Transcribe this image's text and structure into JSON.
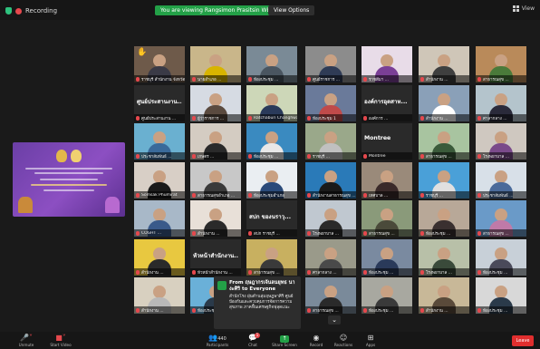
{
  "topbar": {
    "recording_label": "Recording",
    "viewing_banner": "You are viewing Rangsimon Prasitsin WBP's screen",
    "view_options_label": "View Options",
    "view_label": "View"
  },
  "chat_popup": {
    "from_label": "From ฤษฎากรเจ้นลนยุทธ นางะศิริ to Everyone",
    "message": "สำนักโรง ฝุ่นดำนลุ่มฤษฎษาศิริ ศูนย์ป้องกันและควบคุมการจัดการความสุขภาพ ภาคฟื้นเศรษฐกิจฟุลุดแนะ"
  },
  "toolbar": {
    "unmute_label": "Unmute",
    "start_video_label": "Start Video",
    "participants_label": "Participants",
    "participants_count": "440",
    "chat_label": "Chat",
    "chat_badge": "1",
    "share_screen_label": "Share Screen",
    "record_label": "Record",
    "reactions_label": "Reactions",
    "apps_label": "Apps",
    "leave_label": "Leave"
  },
  "tiles": [
    {
      "name": "ราชบุรี สำนักงาน จังหวัด",
      "video": true,
      "bg": "#6e5a4a",
      "body": "#3a3a46",
      "hand": true
    },
    {
      "name": "นายอำเภอ ...",
      "video": true,
      "bg": "#c9b68a",
      "body": "#d8b400"
    },
    {
      "name": "ห้องประชุม ...",
      "video": true,
      "bg": "#7a8a96",
      "body": "#4a5560"
    },
    {
      "name": "ศูนย์ราชการ ...",
      "video": true,
      "bg": "#8c8c8c",
      "body": "#2f3b55"
    },
    {
      "name": "ราชสีมา ...",
      "video": true,
      "bg": "#e8dce8",
      "body": "#7a3f96"
    },
    {
      "name": "สำนักงาน ...",
      "video": true,
      "bg": "#cfc6b8",
      "body": "#3f3f3f"
    },
    {
      "name": "สาธารณสุข ...",
      "video": true,
      "bg": "#b98a5a",
      "body": "#4a7a3a"
    },
    {
      "big": "ศูนย์ประสานงาน...",
      "name": "ศูนย์ประสานงาน ...",
      "video": false
    },
    {
      "name": "ผู้ว่าราชการ ...",
      "video": true,
      "bg": "#d6dbe3",
      "body": "#5a4a3f"
    },
    {
      "name": "Ratchaburi Changhwat",
      "video": true,
      "bg": "#cdd7b8",
      "body": "#2a3a5a"
    },
    {
      "name": "ห้องประชุม 1",
      "video": true,
      "bg": "#6a7a9a",
      "body": "#c04a4a"
    },
    {
      "big": "องค์การอุตสาห...",
      "name": "องค์การ ...",
      "video": false
    },
    {
      "name": "สำนักงาน ...",
      "video": true,
      "bg": "#8aa0b8",
      "body": "#ffffff"
    },
    {
      "name": "ศาลากลาง ...",
      "video": true,
      "bg": "#b4c4cc",
      "body": "#2a2a3a"
    },
    {
      "name": "ประชาสัมพันธ์ ...",
      "video": true,
      "bg": "#6ab0d0",
      "body": "#3a6a9a"
    },
    {
      "name": "เกษตร ...",
      "video": true,
      "bg": "#d4ccc2",
      "body": "#2a2a2a"
    },
    {
      "name": "ห้องประชุม ...",
      "video": true,
      "bg": "#3a8ac0",
      "body": "#e8e8e8"
    },
    {
      "name": "ราชบุรี ...",
      "video": true,
      "bg": "#9aa88a",
      "body": "#c0c0c0"
    },
    {
      "big": "Montree",
      "name": "Montree",
      "video": false
    },
    {
      "name": "สาธารณสุข ...",
      "video": true,
      "bg": "#a8c4a0",
      "body": "#3a5a3a"
    },
    {
      "name": "โรงพยาบาล ...",
      "video": true,
      "bg": "#cfc8c0",
      "body": "#7a4a8a"
    },
    {
      "name": "Somsak Phumirat",
      "video": true,
      "bg": "#d8cfc6",
      "body": "#1a1a1a"
    },
    {
      "name": "สาธารณสุขอำเภอ ...",
      "video": true,
      "bg": "#c8c8c8",
      "body": "#3a3a3a"
    },
    {
      "name": "ห้องประชุมอำเภอ",
      "video": true,
      "bg": "#eaeef2",
      "body": "#2a4a7a"
    },
    {
      "name": "สำนักงานสาธารณสุข ...",
      "video": true,
      "bg": "#2a7ab8",
      "body": "#1a1a1a"
    },
    {
      "name": "เทศบาล ...",
      "video": true,
      "bg": "#9a8a7a",
      "body": "#3a2a2a"
    },
    {
      "name": "ราชบุรี ...",
      "video": true,
      "bg": "#4aa0d8",
      "body": "#e0e0e0"
    },
    {
      "name": "ประชาสัมพันธ์ ...",
      "video": true,
      "bg": "#d8e0e8",
      "body": "#4a6a9a"
    },
    {
      "name": "COGHT ...",
      "video": true,
      "bg": "#a8b8c8",
      "body": "#3a5a8a"
    },
    {
      "name": "สำนักงาน ...",
      "video": true,
      "bg": "#e8e0d8",
      "body": "#2a2a2a"
    },
    {
      "big": "สปก ของนราวุ...",
      "name": "สปก ราชบุรี ...",
      "video": false
    },
    {
      "name": "โรงพยาบาล ...",
      "video": true,
      "bg": "#c0c8d0",
      "body": "#2a2a2a"
    },
    {
      "name": "สาธารณสุข ...",
      "video": true,
      "bg": "#8a9a7a",
      "body": "#4a4a3a"
    },
    {
      "name": "ห้องประชุม ...",
      "video": true,
      "bg": "#b8a898",
      "body": "#3a3030"
    },
    {
      "name": "สาธารณสุข ...",
      "video": true,
      "bg": "#6a9ac8",
      "body": "#c07aa8"
    },
    {
      "name": "สำนักงาน ...",
      "video": true,
      "bg": "#e8c840",
      "body": "#2a2a2a"
    },
    {
      "big": "หัวหน้าสำนักงาน...",
      "name": "หัวหน้าสำนักงาน ...",
      "video": false
    },
    {
      "name": "สาธารณสุข ...",
      "video": true,
      "bg": "#c8b060",
      "body": "#3a3a3a"
    },
    {
      "name": "ศาลากลาง ...",
      "video": true,
      "bg": "#9a9a8a",
      "body": "#4a4a4a"
    },
    {
      "name": "ห้องประชุม ...",
      "video": true,
      "bg": "#7a8aa0",
      "body": "#2a3a5a"
    },
    {
      "name": "โรงพยาบาล ...",
      "video": true,
      "bg": "#b8c0a8",
      "body": "#3a4a3a"
    },
    {
      "name": "ห้องประชุม ...",
      "video": true,
      "bg": "#c8d0d8",
      "body": "#4a4a5a"
    },
    {
      "name": "สำนักงาน ...",
      "video": true,
      "bg": "#d8d0c0",
      "body": "#b8b8b8"
    },
    {
      "name": "ห้องประชุม ...",
      "video": true,
      "bg": "#6ab0d8",
      "body": "#2a3a4a"
    },
    {
      "empty": true,
      "name": "",
      "video": false
    },
    {
      "name": "สาธารณสุข ...",
      "video": true,
      "bg": "#7a8a9a",
      "body": "#2a2a2a"
    },
    {
      "name": "ห้องประชุม ...",
      "video": true,
      "bg": "#a8a8a0",
      "body": "#3a3a3a"
    },
    {
      "name": "สำนักงาน ...",
      "video": true,
      "bg": "#c8b898",
      "body": "#5a4a3a"
    },
    {
      "name": "ห้องประชุม ...",
      "video": true,
      "bg": "#d8d8d8",
      "body": "#2a3a4a"
    }
  ]
}
